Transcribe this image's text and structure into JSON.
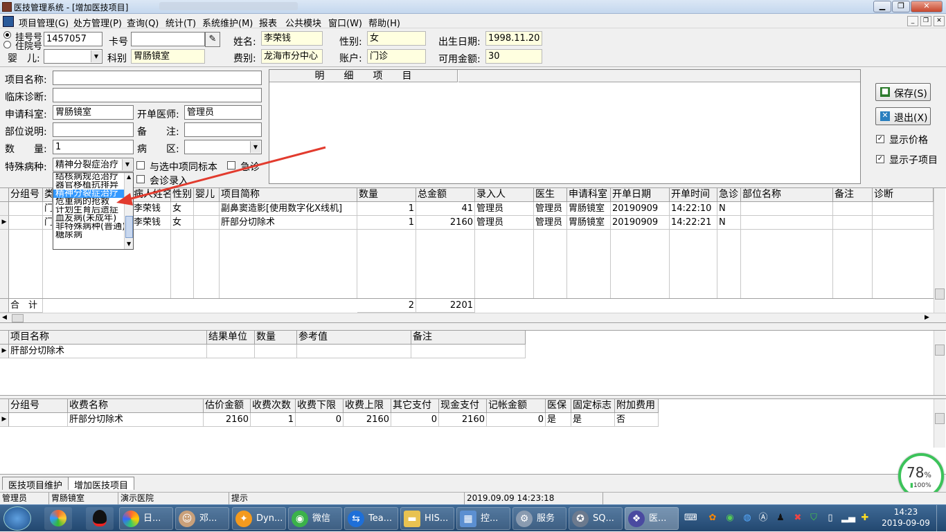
{
  "window": {
    "title": "医技管理系统 - [增加医技项目]"
  },
  "menubar": {
    "items": [
      "项目管理(G)",
      "处方管理(P)",
      "查询(Q)",
      "统计(T)",
      "系统维护(M)",
      "报表",
      "公共模块",
      "窗口(W)",
      "帮助(H)"
    ]
  },
  "patient": {
    "radio_register": "挂号号",
    "radio_inpatient": "住院号",
    "register_no": "1457057",
    "card_label": "卡号",
    "card_value": "",
    "name_label": "姓名:",
    "name_value": "李荣钱",
    "gender_label": "性别:",
    "gender_value": "女",
    "dob_label": "出生日期:",
    "dob_value": "1998.11.20",
    "infant_label": "婴　儿:",
    "infant_value": "",
    "dept_label": "科别",
    "dept_value": "胃肠镜室",
    "fee_label": "费别:",
    "fee_value": "龙海市分中心",
    "account_label": "账户:",
    "account_value": "门诊",
    "balance_label": "可用金额:",
    "balance_value": "30"
  },
  "form": {
    "item_name_label": "项目名称:",
    "item_name_value": "",
    "diagnosis_label": "临床诊断:",
    "diagnosis_value": "",
    "apply_dept_label": "申请科室:",
    "apply_dept_value": "胃肠镜室",
    "doctor_label": "开单医师:",
    "doctor_value": "管理员",
    "part_label": "部位说明:",
    "part_value": "",
    "remark_label": "备　　注:",
    "remark_value": "",
    "qty_label": "数　　量:",
    "qty_value": "1",
    "ward_label": "病　　区:",
    "ward_value": "",
    "special_label": "特殊病种:",
    "special_value": "精神分裂症治疗",
    "same_specimen_label": "与选中项同标本",
    "urgent_label": "急诊",
    "consult_label": "会诊录入"
  },
  "dropdown": {
    "options": [
      "结核病规范治疗",
      "器官移植抗排异",
      "精神分裂症治疗",
      "危重病的抢救",
      "计划生育后遗症",
      "血友病(未成年)",
      "非特殊病种(普通)",
      "糖尿病"
    ],
    "selected_index": 2
  },
  "detail_panel": {
    "header": "明　　细　　项　　目"
  },
  "actions": {
    "save_label": "保存(S)",
    "exit_label": "退出(X)",
    "show_price_label": "显示价格",
    "show_price_checked": true,
    "show_sub_label": "显示子项目",
    "show_sub_checked": true
  },
  "main_table": {
    "columns": [
      "分组号",
      "类",
      "病人姓名",
      "性别",
      "婴儿",
      "项目简称",
      "数量",
      "总金额",
      "录入人",
      "医生",
      "申请科室",
      "开单日期",
      "开单时间",
      "急诊",
      "部位名称",
      "备注",
      "诊断"
    ],
    "rows": [
      [
        "",
        "门",
        "李荣钱",
        "女",
        "",
        "副鼻窦造影[使用数字化X线机]",
        "1",
        "41",
        "管理员",
        "管理员",
        "胃肠镜室",
        "20190909",
        "14:22:10",
        "N",
        "",
        "",
        ""
      ],
      [
        "",
        "门",
        "李荣钱",
        "女",
        "",
        "肝部分切除术",
        "1",
        "2160",
        "管理员",
        "管理员",
        "胃肠镜室",
        "20190909",
        "14:22:21",
        "N",
        "",
        "",
        ""
      ]
    ],
    "current_row": 1,
    "total_label": "合　计",
    "total_qty": "2",
    "total_amount": "2201"
  },
  "sub_table": {
    "columns": [
      "项目名称",
      "结果单位",
      "数量",
      "参考值",
      "备注"
    ],
    "rows": [
      [
        "肝部分切除术",
        "",
        "",
        "",
        ""
      ]
    ]
  },
  "fee_table": {
    "columns": [
      "分组号",
      "收费名称",
      "估价金额",
      "收费次数",
      "收费下限",
      "收费上限",
      "其它支付",
      "现金支付",
      "记帐金额",
      "医保",
      "固定标志",
      "附加费用"
    ],
    "rows": [
      [
        "",
        "肝部分切除术",
        "2160",
        "1",
        "0",
        "2160",
        "0",
        "2160",
        "0",
        "是",
        "是",
        "否"
      ]
    ]
  },
  "tabs": [
    "医技项目维护",
    "增加医技项目"
  ],
  "status": {
    "user": "管理员",
    "dept": "胃肠镜室",
    "hospital": "演示医院",
    "hint": "提示",
    "datetime": "2019.09.09 14:23:18"
  },
  "widget": {
    "percent": "78",
    "percent_unit": "%",
    "sub": "100%"
  },
  "taskbar": {
    "items": [
      "日...",
      "邓...",
      "Dyn...",
      "微信",
      "Tea...",
      "HIS...",
      "控...",
      "服务",
      "SQ...",
      "医..."
    ],
    "time": "14:23",
    "date": "2019-09-09"
  }
}
